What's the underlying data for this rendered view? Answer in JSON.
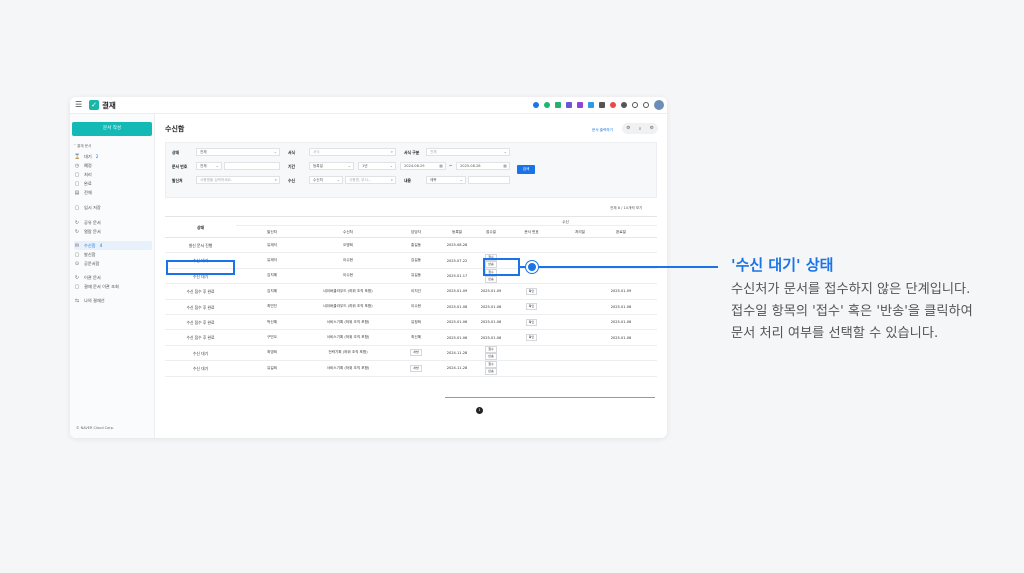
{
  "app": {
    "title": "결재"
  },
  "sidebar": {
    "compose_label": "문서 작성",
    "group_label": "˅ 결재 문서",
    "items": [
      {
        "icon": "⌛",
        "label": "대기",
        "count": "2"
      },
      {
        "icon": "◷",
        "label": "예정",
        "count": ""
      },
      {
        "icon": "▢",
        "label": "처리",
        "count": ""
      },
      {
        "icon": "▢",
        "label": "완료",
        "count": ""
      },
      {
        "icon": "▤",
        "label": "전체",
        "count": ""
      },
      {
        "icon": "▢",
        "label": "임시 저장",
        "count": ""
      },
      {
        "icon": "↻",
        "label": "공유 문서",
        "count": ""
      },
      {
        "icon": "↻",
        "label": "열람 문서",
        "count": ""
      },
      {
        "icon": "✉",
        "label": "수신함",
        "count": "4"
      },
      {
        "icon": "▢",
        "label": "발신함",
        "count": ""
      },
      {
        "icon": "⊙",
        "label": "공문서함",
        "count": ""
      },
      {
        "icon": "↻",
        "label": "이관 문서",
        "count": ""
      },
      {
        "icon": "▢",
        "label": "결재 문서 이관 조회",
        "count": ""
      },
      {
        "icon": "⇆",
        "label": "나의 결재선",
        "count": ""
      }
    ],
    "copyright": "© NAVER Cloud Corp."
  },
  "main": {
    "title": "수신함",
    "link": "문서 출력하기"
  },
  "filter": {
    "status_label": "상태",
    "status_value": "전체",
    "form_label": "서식",
    "form_placeholder": "서식",
    "form_type_label": "서식 구분",
    "form_type_value": "전체",
    "docno_label": "문서 번호",
    "docno_value": "전체",
    "period_label": "기간",
    "period_type": "등록일",
    "period_range": "1년",
    "date_from": "2024.08.29",
    "date_sep": "~",
    "date_to": "2025.08.28",
    "sender_label": "발신처",
    "sender_placeholder": "사용명을 입력하세요.",
    "receive_label": "수신",
    "receive_type": "수신처",
    "receive_placeholder": "사용명, 부서...",
    "content_label": "내용",
    "content_type": "제목",
    "search_label": "검색"
  },
  "view_count": "전체 8 / 10개씩 보기",
  "table": {
    "status_header": "상태",
    "group_header": "수신",
    "headers": [
      "",
      "발신처",
      "수신처",
      "담당자",
      "등록일",
      "접수일",
      "문서 번호",
      "처리일",
      "완료일"
    ],
    "accept_label": "접수",
    "return_label": "반송",
    "check_label": "확인",
    "rows": [
      {
        "status": "발신 문서 진행",
        "sender": "유재석",
        "receiver": "오명희",
        "manager": "홍길동",
        "date": "2025.08.28",
        "received": "",
        "docno": "",
        "processed": "",
        "done": "",
        "buttons": false,
        "check": false
      },
      {
        "status": "수신 대기",
        "sender": "유재석",
        "receiver": "이수현",
        "manager": "김길동",
        "date": "2025.07.22",
        "received": "",
        "docno": "",
        "processed": "",
        "done": "",
        "buttons": true,
        "check": false
      },
      {
        "status": "수신 대기",
        "sender": "김지혜",
        "receiver": "이수현",
        "manager": "유길동",
        "date": "2025.01.17",
        "received": "",
        "docno": "",
        "processed": "",
        "done": "",
        "buttons": true,
        "check": false
      },
      {
        "status": "수신 접수 후 완료",
        "sender": "김지혜",
        "receiver": "네이버클라우드 (하위 조직 포함)",
        "manager": "이지선",
        "date": "2025.01.09",
        "received": "2025.01.09",
        "docno": "",
        "processed": "",
        "done": "2025.01.09",
        "buttons": false,
        "check": true
      },
      {
        "status": "수신 접수 후 완료",
        "sender": "최민진",
        "receiver": "네이버클라우드 (하위 조직 포함)",
        "manager": "이수현",
        "date": "2025.01.06",
        "received": "2025.01.06",
        "docno": "",
        "processed": "",
        "done": "2025.01.06",
        "buttons": false,
        "check": true
      },
      {
        "status": "수신 접수 후 완료",
        "sender": "박신혜",
        "receiver": "서비스기획 (하위 조직 포함)",
        "manager": "유정희",
        "date": "2025.01.06",
        "received": "2025.01.06",
        "docno": "",
        "processed": "",
        "done": "2025.01.06",
        "buttons": false,
        "check": true
      },
      {
        "status": "수신 접수 후 완료",
        "sender": "구민오",
        "receiver": "서비스기획 (하위 조직 포함)",
        "manager": "최신혜",
        "date": "2025.01.06",
        "received": "2025.01.06",
        "docno": "",
        "processed": "",
        "done": "2025.01.06",
        "buttons": false,
        "check": true
      },
      {
        "status": "수신 대기",
        "sender": "최영희",
        "receiver": "전략기획 (하위 조직 포함)",
        "manager": "처방",
        "date": "2024.11.28",
        "received": "",
        "docno": "",
        "processed": "",
        "done": "",
        "buttons": true,
        "check": false
      },
      {
        "status": "수신 대기",
        "sender": "유길희",
        "receiver": "서비스기획 (하위 조직 포함)",
        "manager": "처방",
        "date": "2024.11.28",
        "received": "",
        "docno": "",
        "processed": "",
        "done": "",
        "buttons": true,
        "check": false
      }
    ]
  },
  "pager": {
    "current": "1"
  },
  "annotation": {
    "title": "'수신 대기' 상태",
    "lines": [
      "수신처가 문서를 접수하지 않은 단계입니다.",
      "접수일 항목의 '접수' 혹은 '반송'을 클릭하여",
      "문서 처리 여부를 선택할 수 있습니다."
    ]
  }
}
